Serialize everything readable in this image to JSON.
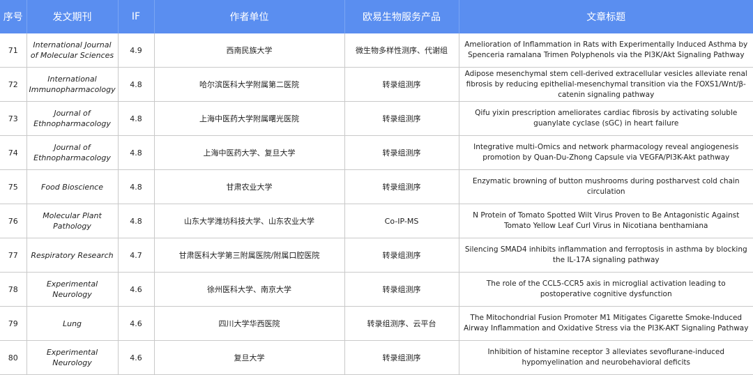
{
  "headers": [
    "序号",
    "发文期刊",
    "IF",
    "作者单位",
    "欧易生物服务产品",
    "文章标题"
  ],
  "rows": [
    {
      "no": "71",
      "journal": "International Journal of Molecular Sciences",
      "if": "4.9",
      "unit": "西南民族大学",
      "product": "微生物多样性测序、代谢组",
      "title": "Amelioration of Inflammation in Rats with Experimentally Induced Asthma by Spenceria ramalana Trimen Polyphenols via the PI3K/Akt Signaling Pathway"
    },
    {
      "no": "72",
      "journal": "International Immunopharmacology",
      "if": "4.8",
      "unit": "哈尔滨医科大学附属第二医院",
      "product": "转录组测序",
      "title": "Adipose mesenchymal stem cell-derived extracellular vesicles alleviate renal fibrosis by reducing epithelial-mesenchymal transition via the FOXS1/Wnt/β-catenin signaling pathway"
    },
    {
      "no": "73",
      "journal": "Journal of Ethnopharmacology",
      "if": "4.8",
      "unit": "上海中医药大学附属曙光医院",
      "product": "转录组测序",
      "title": "Qifu yixin prescription ameliorates cardiac fibrosis by activating soluble guanylate cyclase (sGC) in heart failure"
    },
    {
      "no": "74",
      "journal": "Journal of Ethnopharmacology",
      "if": "4.8",
      "unit": "上海中医药大学、复旦大学",
      "product": "转录组测序",
      "title": "Integrative multi-Omics and network pharmacology reveal angiogenesis promotion by Quan-Du-Zhong Capsule via VEGFA/PI3K-Akt pathway"
    },
    {
      "no": "75",
      "journal": "Food Bioscience",
      "if": "4.8",
      "unit": "甘肃农业大学",
      "product": "转录组测序",
      "title": "Enzymatic browning of button mushrooms during postharvest cold chain circulation"
    },
    {
      "no": "76",
      "journal": "Molecular Plant Pathology",
      "if": "4.8",
      "unit": "山东大学潍坊科技大学、山东农业大学",
      "product": "Co-IP-MS",
      "title": "N Protein of Tomato Spotted Wilt Virus Proven to Be Antagonistic Against Tomato Yellow Leaf Curl Virus in Nicotiana benthamiana"
    },
    {
      "no": "77",
      "journal": "Respiratory Research",
      "if": "4.7",
      "unit": "甘肃医科大学第三附属医院/附属口腔医院",
      "product": "转录组测序",
      "title": "Silencing SMAD4 inhibits inflammation and ferroptosis in asthma by blocking the IL-17A signaling pathway"
    },
    {
      "no": "78",
      "journal": "Experimental Neurology",
      "if": "4.6",
      "unit": "徐州医科大学、南京大学",
      "product": "转录组测序",
      "title": "The role of the CCL5-CCR5 axis in microglial activation leading to postoperative cognitive dysfunction"
    },
    {
      "no": "79",
      "journal": "Lung",
      "if": "4.6",
      "unit": "四川大学华西医院",
      "product": "转录组测序、云平台",
      "title": "The Mitochondrial Fusion Promoter M1 Mitigates Cigarette Smoke-Induced Airway Inflammation and Oxidative Stress via the PI3K-AKT Signaling Pathway"
    },
    {
      "no": "80",
      "journal": "Experimental Neurology",
      "if": "4.6",
      "unit": "复旦大学",
      "product": "转录组测序",
      "title": "Inhibition of histamine receptor 3 alleviates sevoflurane-induced hypomyelination and neurobehavioral deficits"
    }
  ],
  "colors": {
    "header_bg": "#5a8ef0",
    "header_text": "#ffffff",
    "grid": "#c9c9c9"
  }
}
